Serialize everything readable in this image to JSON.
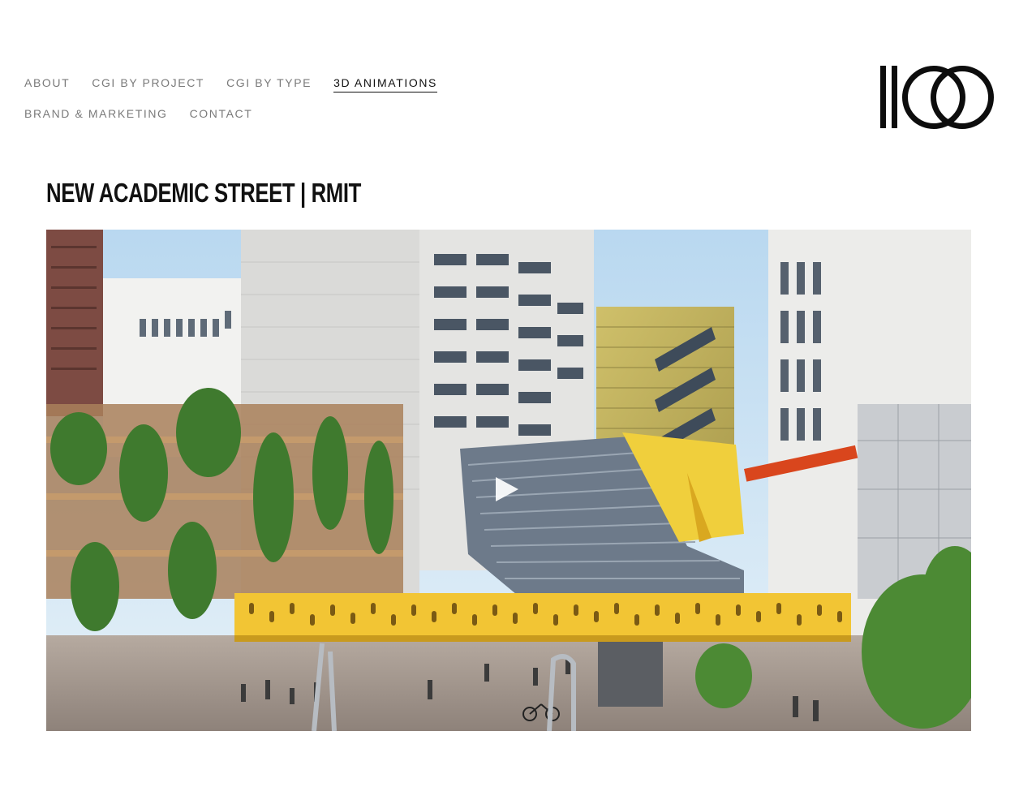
{
  "nav": {
    "row1": [
      {
        "label": "ABOUT",
        "active": false
      },
      {
        "label": "CGI BY PROJECT",
        "active": false
      },
      {
        "label": "CGI BY TYPE",
        "active": false
      },
      {
        "label": "3D ANIMATIONS",
        "active": true
      }
    ],
    "row2": [
      {
        "label": "BRAND & MARKETING",
        "active": false
      },
      {
        "label": "CONTACT",
        "active": false
      }
    ]
  },
  "logo": {
    "text": "1100"
  },
  "page": {
    "title": "NEW ACADEMIC STREET  |  RMIT"
  },
  "video": {
    "play_icon": "play-icon"
  }
}
